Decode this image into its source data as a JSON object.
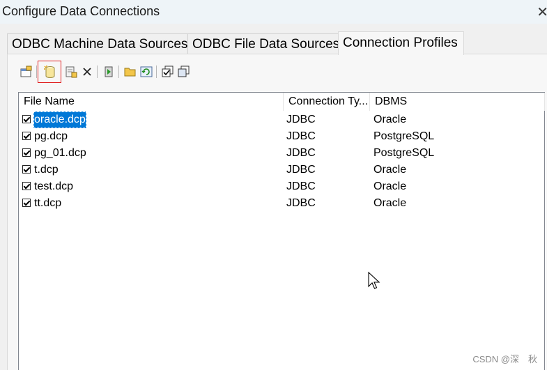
{
  "window": {
    "title": "Configure Data Connections",
    "close": "✕"
  },
  "tabs": [
    {
      "label": "ODBC Machine Data Sources",
      "active": false
    },
    {
      "label": "ODBC File Data Sources",
      "active": false
    },
    {
      "label": "Connection Profiles",
      "active": true
    }
  ],
  "toolbar": {
    "buttons": [
      "properties-icon",
      "new-profile-icon",
      "add-profile-icon",
      "delete-icon",
      "test-connection-icon",
      "open-folder-icon",
      "refresh-icon",
      "check-all-icon",
      "uncheck-all-icon"
    ],
    "highlighted": "new-profile-icon"
  },
  "table": {
    "columns": [
      "File Name",
      "Connection Ty...",
      "DBMS"
    ],
    "rows": [
      {
        "checked": true,
        "file": "oracle.dcp",
        "type": "JDBC",
        "dbms": "Oracle",
        "selected": true
      },
      {
        "checked": true,
        "file": "pg.dcp",
        "type": "JDBC",
        "dbms": "PostgreSQL"
      },
      {
        "checked": true,
        "file": "pg_01.dcp",
        "type": "JDBC",
        "dbms": "PostgreSQL"
      },
      {
        "checked": true,
        "file": "t.dcp",
        "type": "JDBC",
        "dbms": "Oracle"
      },
      {
        "checked": true,
        "file": "test.dcp",
        "type": "JDBC",
        "dbms": "Oracle"
      },
      {
        "checked": true,
        "file": "tt.dcp",
        "type": "JDBC",
        "dbms": "Oracle"
      }
    ]
  },
  "watermark": "CSDN @深　秋",
  "colors": {
    "selection": "#0078d7",
    "highlight_border": "#e02020",
    "titlebar": "#eef4f8"
  }
}
